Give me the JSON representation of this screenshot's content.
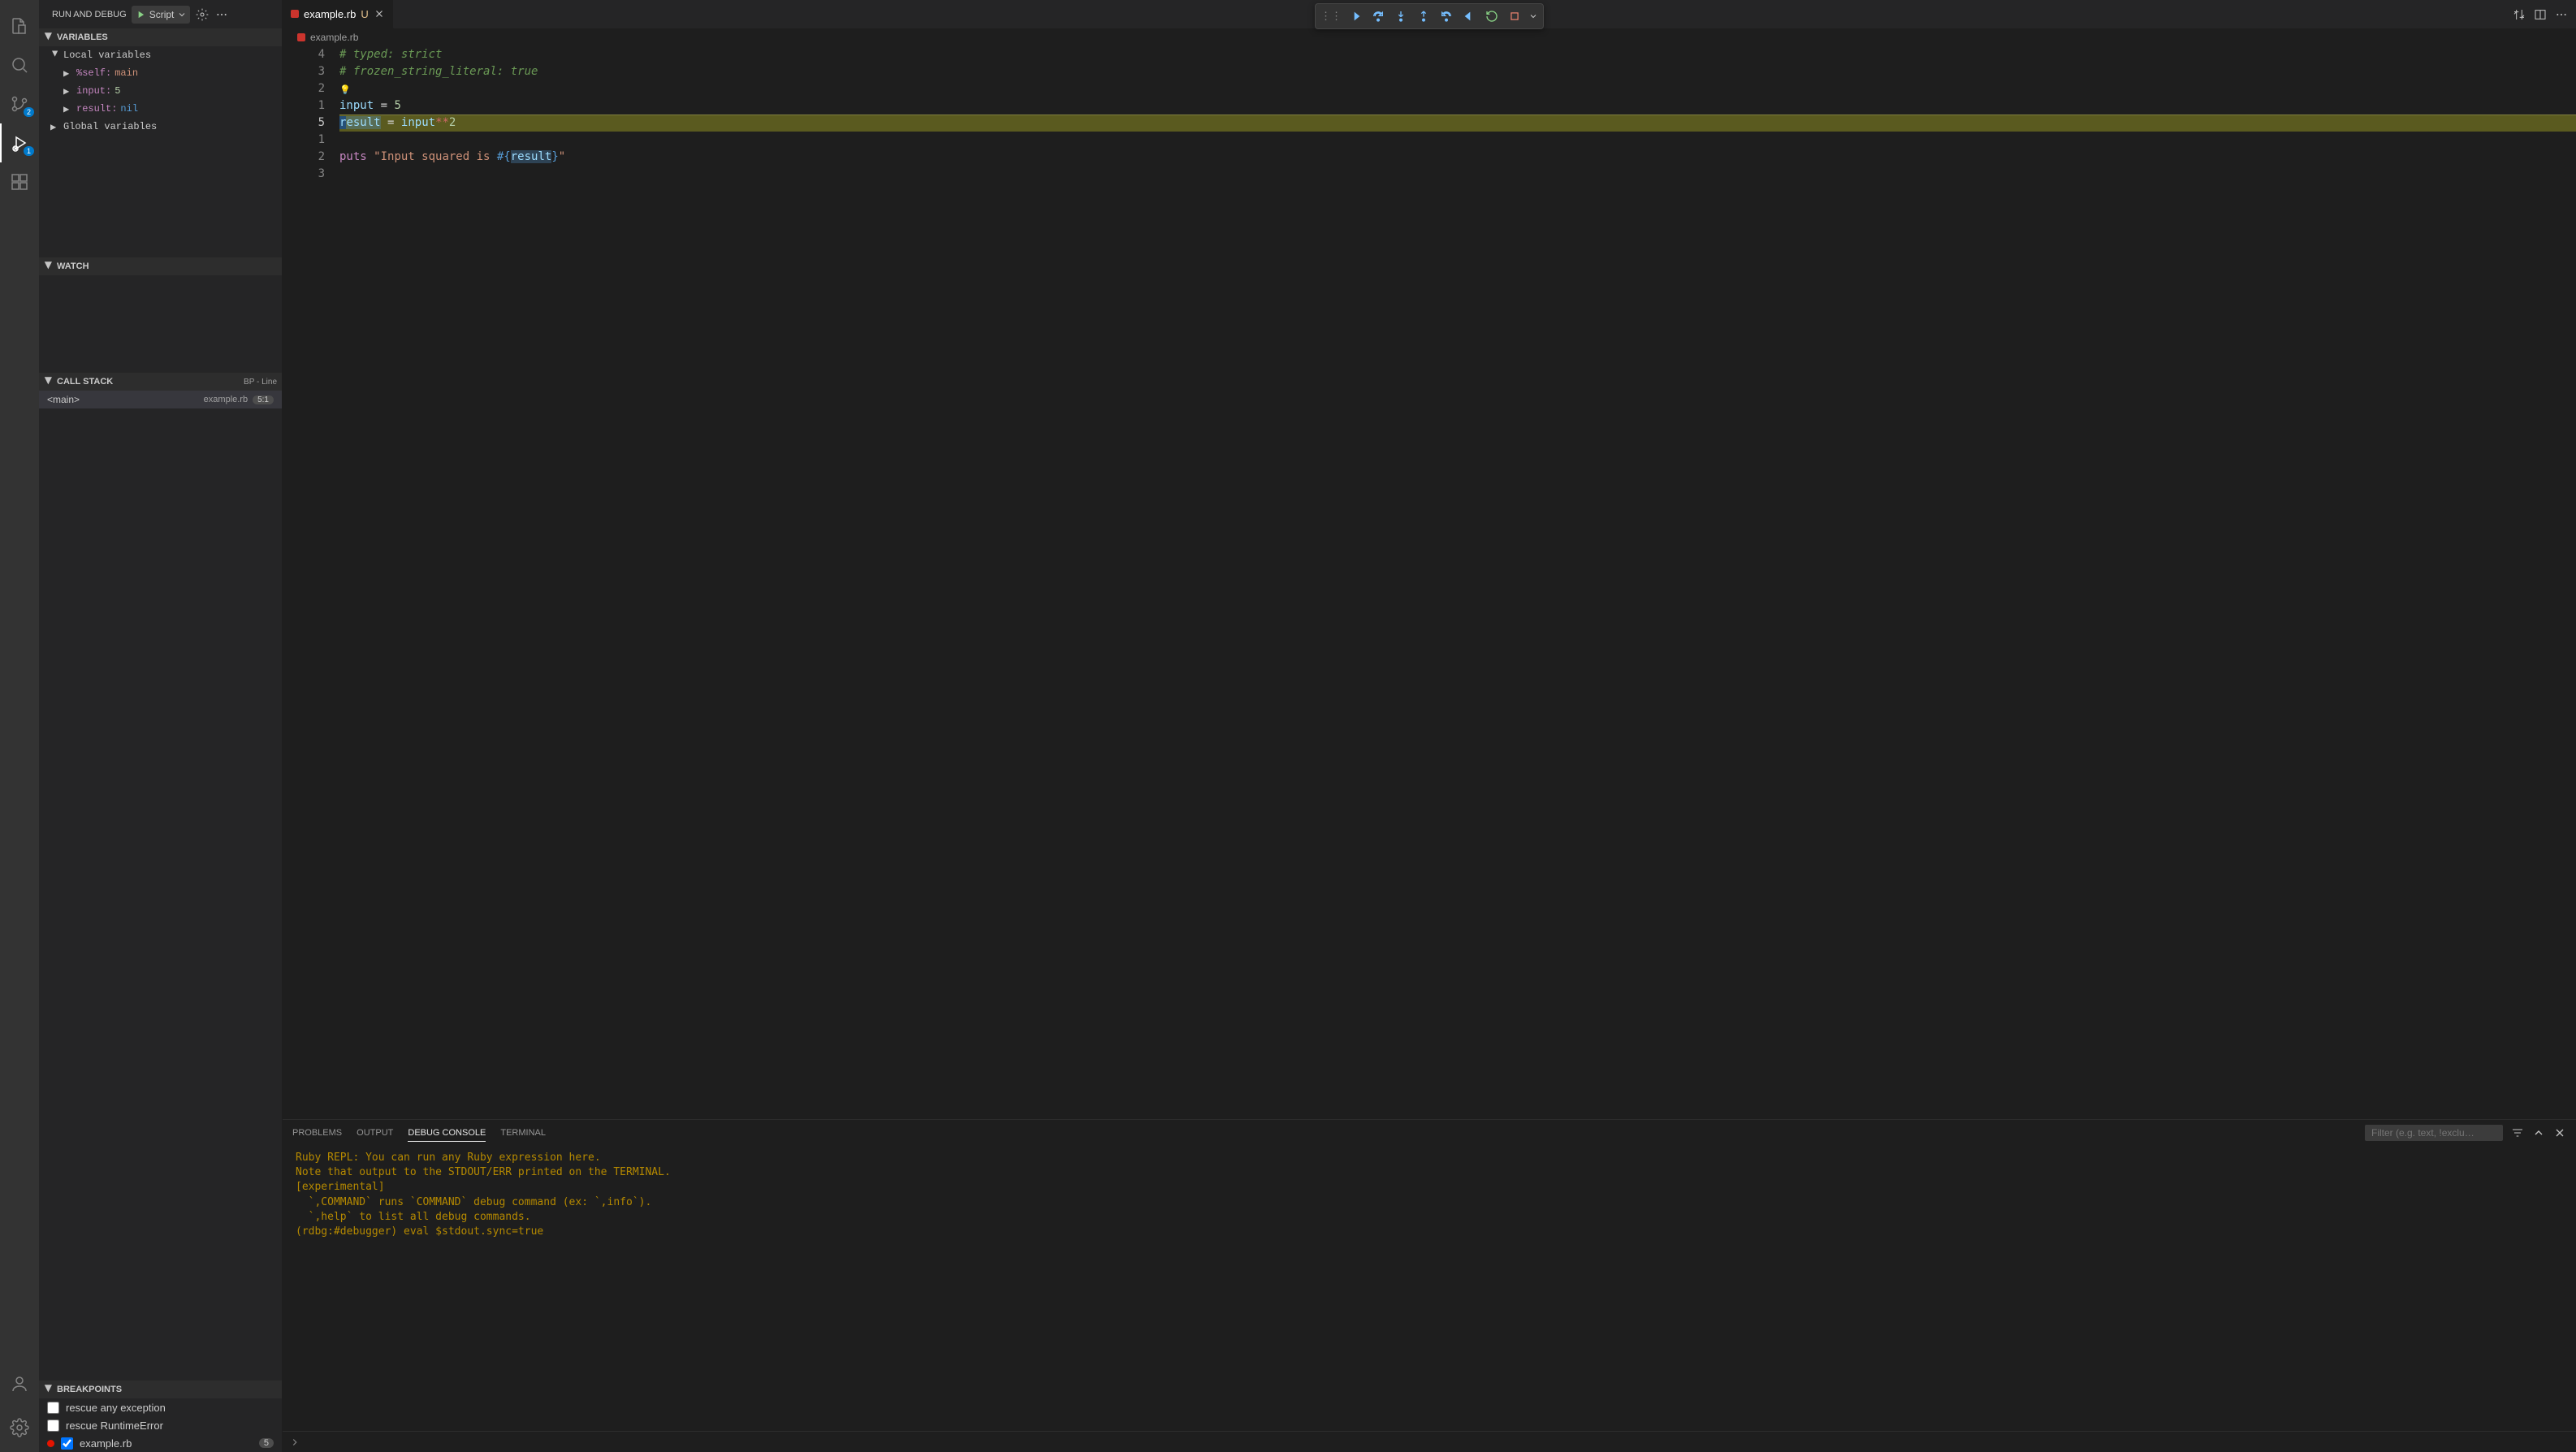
{
  "activity": {
    "scm_badge": "2",
    "debug_badge": "1"
  },
  "sidebar": {
    "title": "RUN AND DEBUG",
    "config_name": "Script",
    "variables": {
      "title": "VARIABLES",
      "local_label": "Local variables",
      "global_label": "Global variables",
      "items": [
        {
          "name": "%self",
          "value": "main",
          "valclass": "varval"
        },
        {
          "name": "input",
          "value": "5",
          "valclass": "varval num"
        },
        {
          "name": "result",
          "value": "nil",
          "valclass": "varval nil"
        }
      ]
    },
    "watch": {
      "title": "WATCH"
    },
    "callstack": {
      "title": "CALL STACK",
      "extra": "BP - Line",
      "frame": "<main>",
      "file": "example.rb",
      "line": "5:1"
    },
    "breakpoints": {
      "title": "BREAKPOINTS",
      "items": [
        {
          "checked": false,
          "label": "rescue any exception",
          "has_dot": false,
          "line": ""
        },
        {
          "checked": false,
          "label": "rescue RuntimeError",
          "has_dot": false,
          "line": ""
        },
        {
          "checked": true,
          "label": "example.rb",
          "has_dot": true,
          "line": "5"
        }
      ]
    }
  },
  "tabs": {
    "file": "example.rb",
    "modified": "U"
  },
  "breadcrumb": {
    "file": "example.rb"
  },
  "editor": {
    "gutter": [
      "4",
      "3",
      "2",
      "1",
      "5",
      "1",
      "2",
      "3"
    ],
    "current_line_idx": 4,
    "lines": [
      {
        "html": "<span class='tok-comment'># typed: strict</span>"
      },
      {
        "html": "<span class='tok-comment'># frozen_string_literal: true</span>"
      },
      {
        "html": ""
      },
      {
        "html": "<span class='tok-var'>input</span> <span class='tok-operator'>=</span> <span class='tok-num'>5</span>"
      },
      {
        "html": "<span class='tok-var tok-var-sel'>r</span><span class='tok-var tok-hl-word'>esult</span> <span class='tok-operator'>=</span> <span class='tok-var'>input</span><span class='tok-power'>**</span><span class='tok-num'>2</span>"
      },
      {
        "html": ""
      },
      {
        "html": "<span class='tok-kw'>puts</span> <span class='tok-str'>\"Input squared is </span><span class='tok-interp'>#{</span><span class='tok-var tok-hl-word'>result</span><span class='tok-interp'>}</span><span class='tok-str'>\"</span>"
      },
      {
        "html": ""
      }
    ]
  },
  "panel": {
    "tabs": [
      "PROBLEMS",
      "OUTPUT",
      "DEBUG CONSOLE",
      "TERMINAL"
    ],
    "active_tab": 2,
    "filter_placeholder": "Filter (e.g. text, !exclu…",
    "lines": [
      "Ruby REPL: You can run any Ruby expression here.",
      "Note that output to the STDOUT/ERR printed on the TERMINAL.",
      "[experimental]",
      "  `,COMMAND` runs `COMMAND` debug command (ex: `,info`).",
      "  `,help` to list all debug commands.",
      "(rdbg:#debugger) eval $stdout.sync=true"
    ]
  }
}
